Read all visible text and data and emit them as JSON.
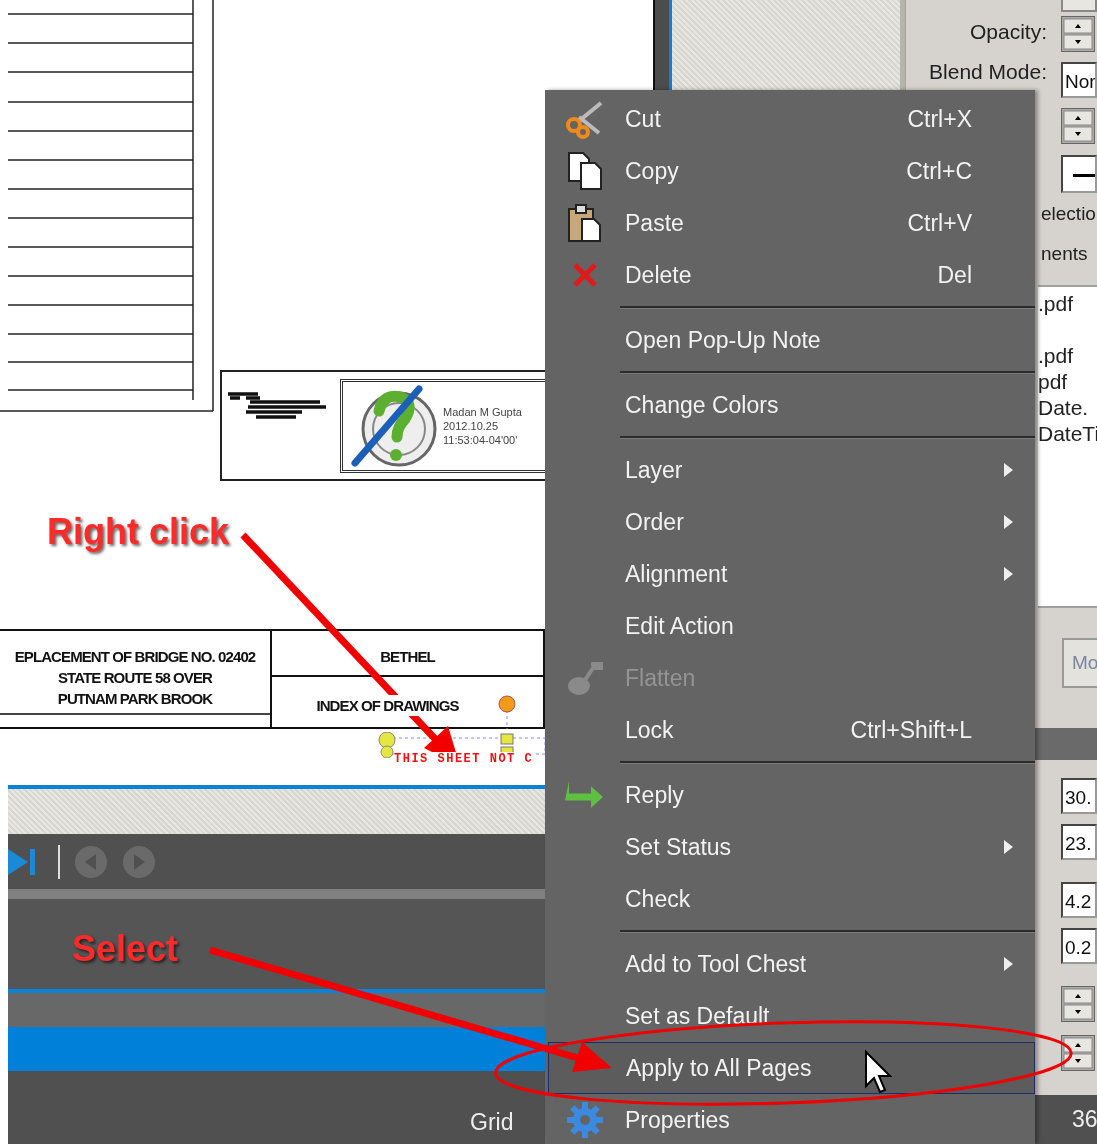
{
  "document": {
    "signature": {
      "lines": [
        "Madan M Gupta",
        "2012.10.25",
        "11:53:04-04'00'"
      ]
    },
    "title_block": {
      "project_title": [
        "EPLACEMENT OF BRIDGE NO. 02402",
        "STATE ROUTE 58 OVER",
        "PUTNAM PARK BROOK"
      ],
      "town": "BETHEL",
      "drawing_title": "INDEX OF DRAWINGS"
    },
    "stamp": {
      "text": "THIS SHEET NOT C",
      "selected": true
    }
  },
  "annotations": [
    {
      "text": "Right click"
    },
    {
      "text": "Select"
    }
  ],
  "status_bar": {
    "label": "Grid"
  },
  "properties_panel": {
    "rows": [
      {
        "kind": "spinner",
        "label": "Opacity:"
      },
      {
        "kind": "field",
        "label": "Blend Mode:",
        "value": "Nor"
      },
      {
        "kind": "spinner"
      },
      {
        "kind": "line_field"
      },
      {
        "kind": "text",
        "text": "electio"
      },
      {
        "kind": "text",
        "text": "nents"
      },
      {
        "kind": "list",
        "items": [
          ".pdf",
          ".pdf",
          "pdf",
          "Date.",
          "DateTi"
        ]
      },
      {
        "kind": "button",
        "label": "Mo"
      },
      {
        "kind": "header"
      },
      {
        "kind": "field",
        "value": "30."
      },
      {
        "kind": "field",
        "value": "23."
      },
      {
        "kind": "field",
        "value": "4.2"
      },
      {
        "kind": "field",
        "value": "0.2"
      },
      {
        "kind": "spinner"
      },
      {
        "kind": "spinner"
      },
      {
        "kind": "footer",
        "text": "36"
      }
    ]
  },
  "context_menu": {
    "items": [
      {
        "kind": "item",
        "label": "Cut",
        "shortcut": "Ctrl+X",
        "submenu": false,
        "disabled": false,
        "selected": false
      },
      {
        "kind": "item",
        "label": "Copy",
        "shortcut": "Ctrl+C",
        "submenu": false,
        "disabled": false,
        "selected": false
      },
      {
        "kind": "item",
        "label": "Paste",
        "shortcut": "Ctrl+V",
        "submenu": false,
        "disabled": false,
        "selected": false
      },
      {
        "kind": "item",
        "label": "Delete",
        "shortcut": "Del",
        "submenu": false,
        "disabled": false,
        "selected": false
      },
      {
        "kind": "separator"
      },
      {
        "kind": "item",
        "label": "Open Pop-Up Note",
        "submenu": false,
        "disabled": false,
        "selected": false
      },
      {
        "kind": "separator"
      },
      {
        "kind": "item",
        "label": "Change Colors",
        "submenu": false,
        "disabled": false,
        "selected": false
      },
      {
        "kind": "separator"
      },
      {
        "kind": "item",
        "label": "Layer",
        "submenu": true,
        "disabled": false,
        "selected": false
      },
      {
        "kind": "item",
        "label": "Order",
        "submenu": true,
        "disabled": false,
        "selected": false
      },
      {
        "kind": "item",
        "label": "Alignment",
        "submenu": true,
        "disabled": false,
        "selected": false
      },
      {
        "kind": "item",
        "label": "Edit Action",
        "submenu": false,
        "disabled": false,
        "selected": false
      },
      {
        "kind": "item",
        "label": "Flatten",
        "submenu": false,
        "disabled": true,
        "selected": false
      },
      {
        "kind": "item",
        "label": "Lock",
        "shortcut": "Ctrl+Shift+L",
        "submenu": false,
        "disabled": false,
        "selected": false
      },
      {
        "kind": "separator"
      },
      {
        "kind": "item",
        "label": "Reply",
        "submenu": false,
        "disabled": false,
        "selected": false
      },
      {
        "kind": "item",
        "label": "Set Status",
        "submenu": true,
        "disabled": false,
        "selected": false
      },
      {
        "kind": "item",
        "label": "Check",
        "submenu": false,
        "disabled": false,
        "selected": false
      },
      {
        "kind": "separator"
      },
      {
        "kind": "item",
        "label": "Add to Tool Chest",
        "submenu": true,
        "disabled": false,
        "selected": false
      },
      {
        "kind": "item",
        "label": "Set as Default",
        "submenu": false,
        "disabled": false,
        "selected": false
      },
      {
        "kind": "item",
        "label": "Apply to All Pages",
        "submenu": false,
        "disabled": false,
        "selected": true
      },
      {
        "kind": "item",
        "label": "Properties",
        "submenu": false,
        "disabled": false,
        "selected": false
      }
    ]
  }
}
